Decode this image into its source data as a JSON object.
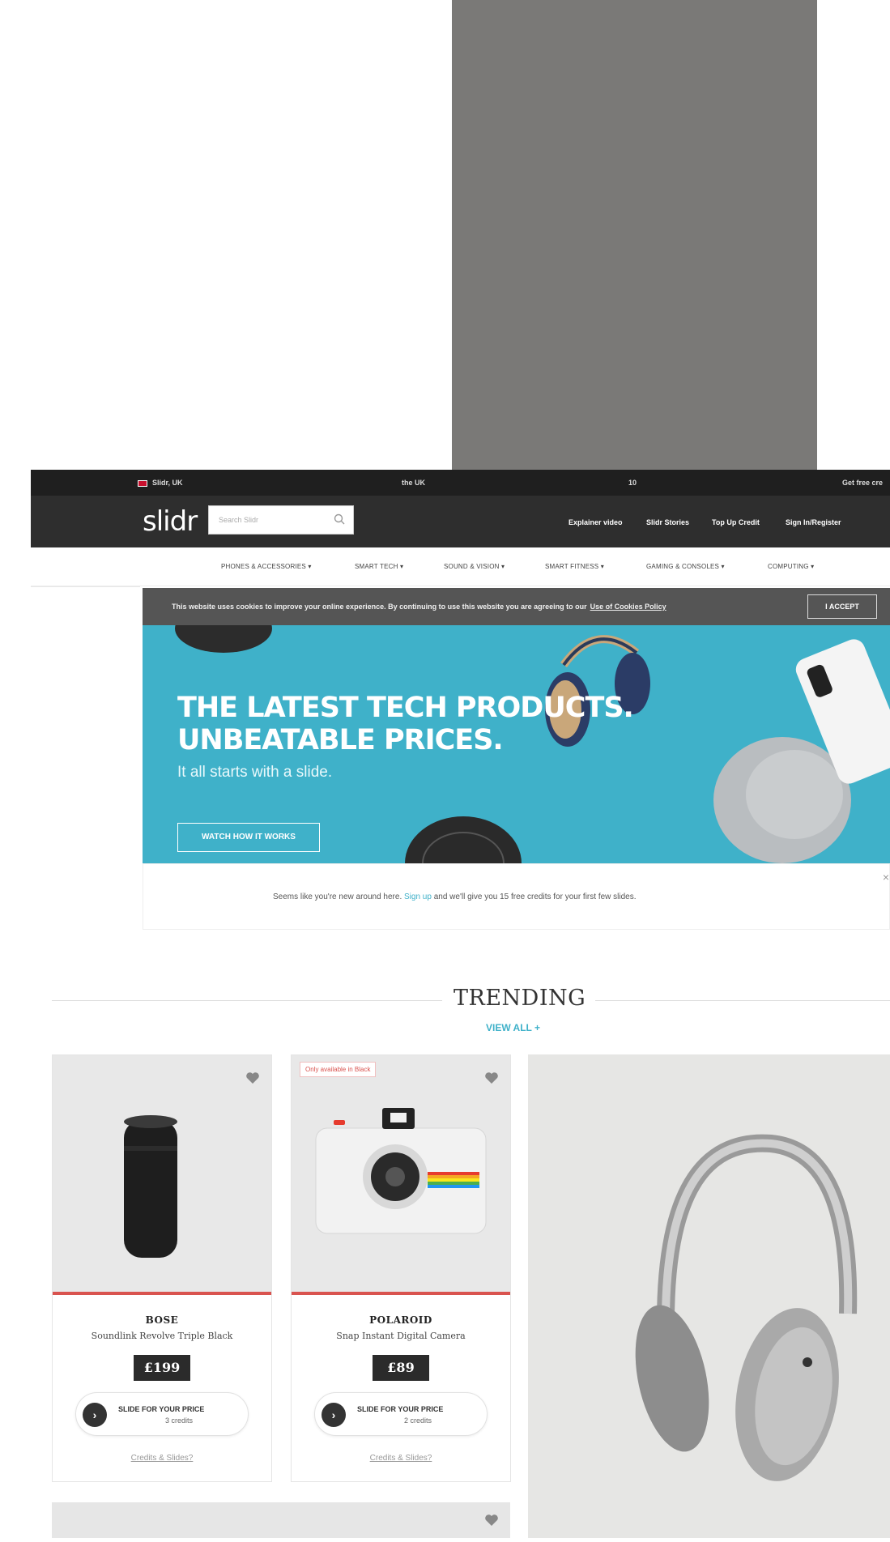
{
  "utility_bar": {
    "left": "Slidr, UK",
    "center": "the UK",
    "mid": "10",
    "right": "Get free cre"
  },
  "header": {
    "logo": "slidr",
    "search_placeholder": "Search Slidr",
    "nav": [
      "Explainer video",
      "Slidr Stories",
      "Top Up Credit",
      "Sign In/Register"
    ]
  },
  "categories": [
    "PHONES & ACCESSORIES ▾",
    "SMART TECH ▾",
    "SOUND & VISION ▾",
    "SMART FITNESS ▾",
    "GAMING & CONSOLES ▾",
    "COMPUTING ▾"
  ],
  "cookie_bar": {
    "text": "This website uses cookies to improve your online experience. By continuing to use this website you are agreeing to our",
    "link": "Use of Cookies Policy",
    "button": "I ACCEPT"
  },
  "hero": {
    "headline_1": "THE LATEST TECH PRODUCTS.",
    "headline_2": "UNBEATABLE PRICES.",
    "subline": "It all starts with a slide.",
    "cta": "WATCH HOW IT WORKS"
  },
  "signup": {
    "pre": "Seems like you're new around here.",
    "link": "Sign up",
    "post": "and we'll give you 15 free credits for your first few slides.",
    "close": "×"
  },
  "trending": {
    "title": "TRENDING",
    "view_all": "VIEW ALL +"
  },
  "products": [
    {
      "brand": "BOSE",
      "name": "Soundlink Revolve Triple Black",
      "price": "£199",
      "slide_label": "SLIDE FOR YOUR PRICE",
      "credits": "3 credits",
      "help": "Credits & Slides?"
    },
    {
      "badge": "Only available in Black",
      "brand": "POLAROID",
      "name": "Snap Instant Digital Camera",
      "price": "£89",
      "slide_label": "SLIDE FOR YOUR PRICE",
      "credits": "2 credits",
      "help": "Credits & Slides?"
    }
  ],
  "colors": {
    "accent": "#3fb1c9",
    "header_bg": "#2e2e2e",
    "util_bg": "#1f1f1f",
    "price_bg": "#2b2b2b",
    "card_rule": "#d9534f"
  },
  "icons": [
    "search-icon",
    "heart-icon",
    "arrow-right-icon",
    "close-icon",
    "uk-flag-icon"
  ]
}
